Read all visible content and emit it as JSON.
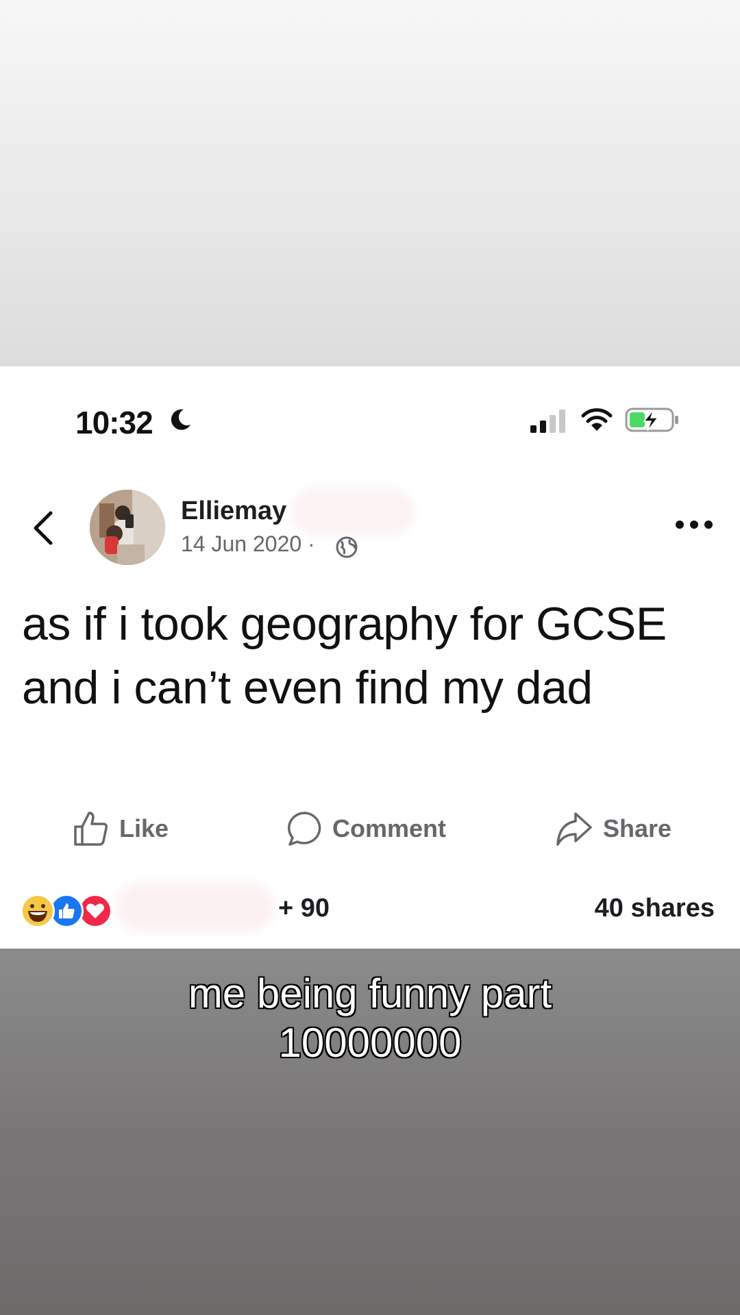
{
  "status_bar": {
    "time": "10:32",
    "icons": [
      "moon-icon",
      "signal-icon",
      "wifi-icon",
      "battery-charging-icon"
    ],
    "battery_color": "#4cd964"
  },
  "post": {
    "author": "Elliemay",
    "date": "14 Jun 2020 ·",
    "privacy_icon": "globe-icon",
    "text": "as if i took geography for GCSE and i can’t even find my dad"
  },
  "actions": {
    "like_label": "Like",
    "comment_label": "Comment",
    "share_label": "Share"
  },
  "engagement": {
    "reactions": [
      "haha",
      "like",
      "love"
    ],
    "reaction_count": "+ 90",
    "shares": "40 shares"
  },
  "caption": {
    "line1": "me being funny part",
    "line2": "10000000"
  },
  "colors": {
    "text_primary": "#1c1e21",
    "text_secondary": "#65676b",
    "like_blue": "#1877f2",
    "love_red": "#f02849",
    "haha_yellow": "#f7c844"
  }
}
